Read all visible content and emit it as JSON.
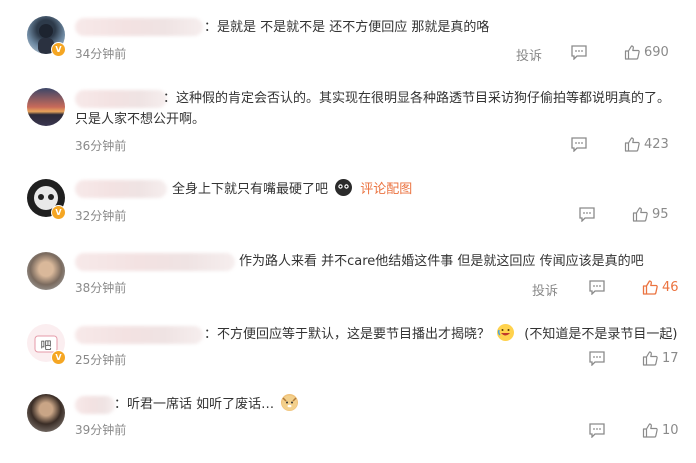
{
  "comments": [
    {
      "text": "：是就是 不是就不是 还不方便回应 那就是真的咯",
      "time": "34分钟前",
      "report": "投诉",
      "likes": "690"
    },
    {
      "text_line1": "：这种假的肯定会否认的。其实现在很明显各种路透节目采访狗仔偷拍等都说明真的了。",
      "text_line2": "只是人家不想公开啊。",
      "time": "36分钟前",
      "likes": "423"
    },
    {
      "text": "全身上下就只有嘴最硬了吧",
      "link": "评论配图",
      "time": "32分钟前",
      "likes": "95"
    },
    {
      "text": "作为路人来看 并不care他结婚这件事 但是就这回应 传闻应该是真的吧",
      "time": "38分钟前",
      "report": "投诉",
      "likes": "46"
    },
    {
      "text_main": "：不方便回应等于默认，这是要节目播出才揭晓？",
      "text_aside": "(不知道是不是录节目一起)",
      "time": "25分钟前",
      "likes": "17"
    },
    {
      "text": "：听君一席话 如听了废话…",
      "time": "39分钟前",
      "likes": "10"
    }
  ],
  "colors": {
    "liked": "#eb7340",
    "muted": "#8a8a8a",
    "badge": "#f5a623"
  },
  "icons": [
    "comment-icon",
    "thumbs-up-icon",
    "verified-badge-icon",
    "emoji-icon"
  ]
}
